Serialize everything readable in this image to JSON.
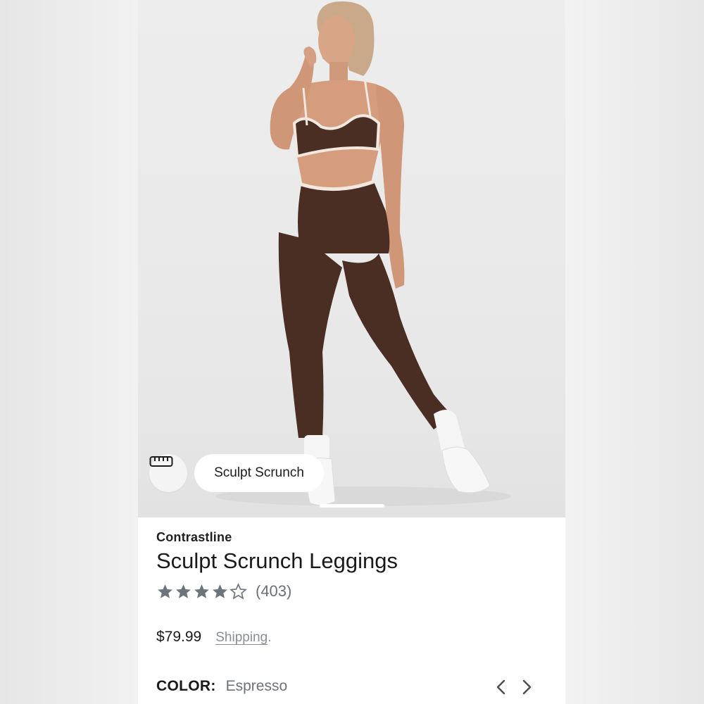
{
  "hero": {
    "fit_icon": "ruler-icon",
    "fit_chip_label": "Sculpt Scrunch"
  },
  "product": {
    "brand": "Contrastline",
    "title": "Sculpt Scrunch Leggings",
    "rating": 4.5,
    "review_count": "(403)",
    "price": "$79.99",
    "shipping_label": "Shipping",
    "shipping_suffix": ".",
    "color_label": "COLOR:",
    "color_value": "Espresso",
    "prev_icon": "chevron-left-icon",
    "next_icon": "chevron-right-icon"
  },
  "colors": {
    "star": "#6e747c",
    "garment": "#4a2e24",
    "trim": "#f2e8df"
  }
}
